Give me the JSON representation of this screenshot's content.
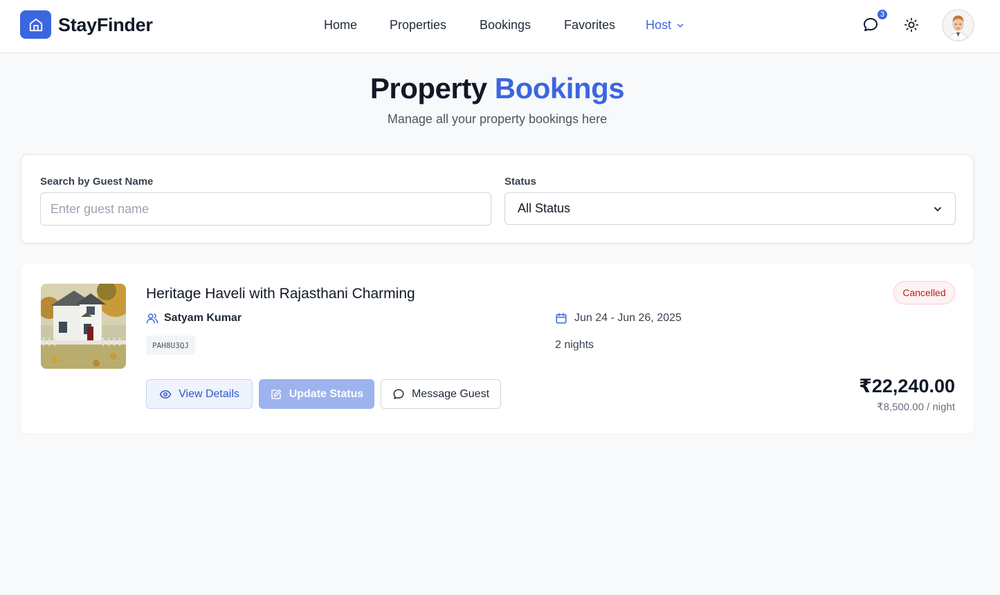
{
  "header": {
    "brand": "StayFinder",
    "nav": [
      "Home",
      "Properties",
      "Bookings",
      "Favorites"
    ],
    "host_label": "Host",
    "message_count": "3",
    "icons": {
      "logo": "home-icon",
      "messages": "chat-bubble-icon",
      "theme": "sun-icon",
      "host_menu": "chevron-down-icon"
    }
  },
  "page": {
    "title_main": "Property",
    "title_accent": "Bookings",
    "subtitle": "Manage all your property bookings here"
  },
  "filters": {
    "search_label": "Search by Guest Name",
    "search_placeholder": "Enter guest name",
    "search_value": "",
    "status_label": "Status",
    "status_value": "All Status"
  },
  "booking": {
    "property_name": "Heritage Haveli with Rajasthani Charming",
    "guest_name": "Satyam Kumar",
    "booking_code": "PAH8U3QJ",
    "dates": "Jun 24 - Jun 26, 2025",
    "nights": "2 nights",
    "status": "Cancelled",
    "total": "₹22,240.00",
    "per_night": "₹8,500.00 / night",
    "actions": {
      "view": "View Details",
      "update": "Update Status",
      "message": "Message Guest"
    }
  },
  "colors": {
    "accent": "#3b66e0",
    "cancelled_bg": "#fef2f2",
    "cancelled_text": "#b91c1c"
  }
}
